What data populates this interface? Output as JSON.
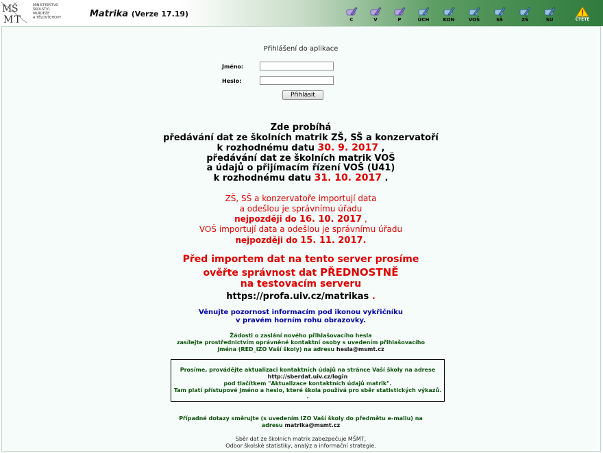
{
  "header": {
    "logo_text": [
      "MINISTERSTVO",
      "ŠKOLSTVÍ,",
      "MLÁDEŽE",
      "A TĚLOVÝCHOVY"
    ],
    "app_title": "Matrika",
    "version": "(Verze 17.19)",
    "toolbar": [
      "C",
      "V",
      "P",
      "ÚCH",
      "KON",
      "VOŠ",
      "SŠ",
      "ZŠ",
      "SU"
    ],
    "warning_label": "ČTĚTE"
  },
  "login": {
    "title": "Přihlášení do aplikace",
    "name_label": "Jméno:",
    "password_label": "Heslo:",
    "name_value": "",
    "password_value": "",
    "submit_label": "Přihlásit"
  },
  "notice": {
    "l1": "Zde probíhá",
    "l2": "předávání dat ze školních matrik ZŠ, SŠ a konzervatoří",
    "l3a": "k rozhodnému datu ",
    "l3b": "30. 9. 2017",
    "l3c": " ,",
    "l4": "předávání dat ze školních matrik VOŠ",
    "l5": "a údajů o přijímacím řízení VOŠ (U41)",
    "l6a": "k rozhodnému datu ",
    "l6b": "31. 10. 2017",
    "l6c": " .",
    "r1": "ZŠ, SŠ a konzervatoře importují data",
    "r2": "a odešlou je správnímu úřadu",
    "r3a": "nejpozději do ",
    "r3b": "16. 10. 2017",
    "r3c": " ,",
    "r4": "VOŠ importují data a odešlou je správnímu úřadu",
    "r5a": "nejpozději do ",
    "r5b": "15. 11. 2017.",
    "p1": "Před importem dat na tento server prosíme",
    "p2a": "ověřte správnost dat ",
    "p2b": "PŘEDNOSTNĚ",
    "p3": "na testovacím serveru",
    "p4a": "https://profa.uiv.cz/matrikas",
    "p4b": " ."
  },
  "attention": {
    "l1": "Věnujte pozornost informacím pod ikonou vykřičníku",
    "l2": "v pravém horním rohu obrazovky."
  },
  "password_request": {
    "l1": "Žádosti o zaslání nového přihlašovacího hesla",
    "l2": "zasílejte prostřednictvím oprávněné kontaktní osoby s uvedením přihlašovacího",
    "l3a": "jména (RED_IZO Vaší školy) na adresu ",
    "l3b": "hesla@msmt.cz"
  },
  "info_box": {
    "l1": "Prosíme, provádějte aktualizaci kontaktních údajů na stránce Vaší školy na adrese",
    "l2": "http://sberdat.uiv.cz/login",
    "l3": "pod tlačítkem \"Aktualizace kontaktních údajů matrik\".",
    "l4": "Tam platí přístupové jméno a heslo, které škola používá pro sběr statistických výkazů.",
    "l5": "."
  },
  "contact": {
    "l1": "Případné dotazy směrujte (s uvedením IZO Vaší školy do předmětu e-mailu) na",
    "l2a": "adresu ",
    "l2b": "matrika@msmt.cz"
  },
  "footer": {
    "l1": "Sběr dat ze školních matrik zabezpečuje MŠMT,",
    "l2": "Odbor školské statistiky, analýz a informační strategie."
  },
  "colors": {
    "accent_red": "#e00000",
    "info_blue": "#0000aa",
    "info_green": "#0a4f0a",
    "header_green": "#2f7a3c"
  },
  "icons": [
    "msmt-logo",
    "pen-icon",
    "warning-icon"
  ]
}
